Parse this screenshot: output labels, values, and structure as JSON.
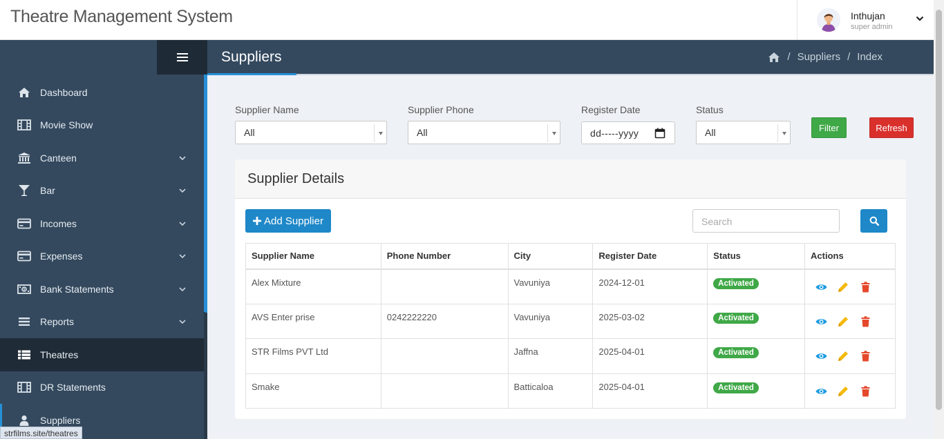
{
  "app": {
    "title": "Theatre Management System"
  },
  "user": {
    "name": "Inthujan",
    "role": "super admin"
  },
  "sidebar": {
    "items": [
      {
        "label": "Dashboard",
        "icon": "home-icon",
        "has_children": false
      },
      {
        "label": "Movie Show",
        "icon": "film-icon",
        "has_children": false
      },
      {
        "label": "Canteen",
        "icon": "bank-icon",
        "has_children": true
      },
      {
        "label": "Bar",
        "icon": "glass-icon",
        "has_children": true
      },
      {
        "label": "Incomes",
        "icon": "credit-card-icon",
        "has_children": true
      },
      {
        "label": "Expenses",
        "icon": "credit-card-icon",
        "has_children": true
      },
      {
        "label": "Bank Statements",
        "icon": "money-icon",
        "has_children": true
      },
      {
        "label": "Reports",
        "icon": "list-icon",
        "has_children": true
      },
      {
        "label": "Theatres",
        "icon": "table-list-icon",
        "has_children": false
      },
      {
        "label": "DR Statements",
        "icon": "film-icon",
        "has_children": false
      },
      {
        "label": "Suppliers",
        "icon": "user-icon",
        "has_children": false
      }
    ]
  },
  "page": {
    "title": "Suppliers",
    "breadcrumb": [
      "Suppliers",
      "Index"
    ]
  },
  "filters": {
    "supplier_name": {
      "label": "Supplier Name",
      "value": "All"
    },
    "supplier_phone": {
      "label": "Supplier Phone",
      "value": "All"
    },
    "register_date": {
      "label": "Register Date",
      "value": "dd-----yyyy"
    },
    "status": {
      "label": "Status",
      "value": "All"
    },
    "filter_label": "Filter",
    "refresh_label": "Refresh"
  },
  "panel": {
    "title": "Supplier Details",
    "add_label": "Add Supplier",
    "search_placeholder": "Search"
  },
  "table": {
    "columns": [
      "Supplier Name",
      "Phone Number",
      "City",
      "Register Date",
      "Status",
      "Actions"
    ],
    "rows": [
      {
        "name": "Alex Mixture",
        "phone": "",
        "city": "Vavuniya",
        "date": "2024-12-01",
        "status": "Activated"
      },
      {
        "name": "AVS Enter prise",
        "phone": "0242222220",
        "city": "Vavuniya",
        "date": "2025-03-02",
        "status": "Activated"
      },
      {
        "name": "STR Films PVT Ltd",
        "phone": "",
        "city": "Jaffna",
        "date": "2025-04-01",
        "status": "Activated"
      },
      {
        "name": "Smake",
        "phone": "",
        "city": "Batticaloa",
        "date": "2025-04-01",
        "status": "Activated"
      }
    ]
  },
  "status_bar": {
    "url": "strfilms.site/theatres"
  },
  "colors": {
    "sidebar_bg": "#34495e",
    "sidebar_active": "#1f2b37",
    "accent_blue": "#2690d6",
    "primary_button": "#1e88c8",
    "success": "#3fa847",
    "danger": "#d9302c",
    "view_icon": "#1a9be0",
    "edit_icon": "#f5b90c",
    "delete_icon": "#e5482b"
  }
}
